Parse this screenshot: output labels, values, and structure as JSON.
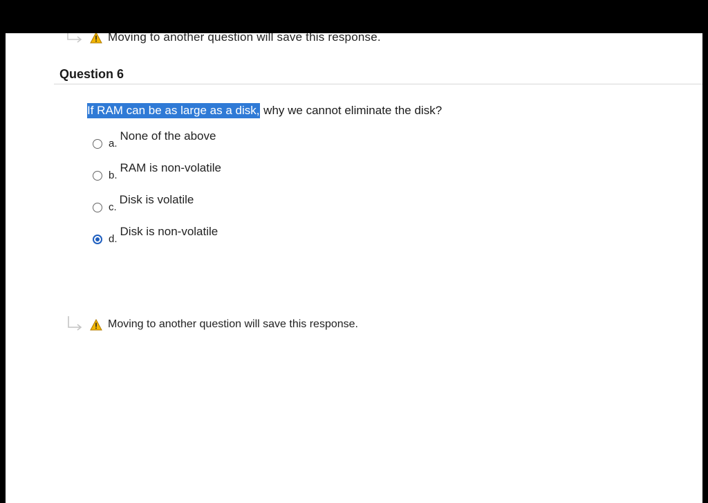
{
  "warning_top": {
    "text": "Moving to another question will save this response."
  },
  "question": {
    "header": "Question 6",
    "text_highlighted": "If RAM can be as large as a disk,",
    "text_rest": " why we cannot eliminate the disk?",
    "options": [
      {
        "letter": "a.",
        "label": "None of the above",
        "selected": false
      },
      {
        "letter": "b.",
        "label": "RAM is non-volatile",
        "selected": false
      },
      {
        "letter": "c.",
        "label": "Disk is volatile",
        "selected": false
      },
      {
        "letter": "d.",
        "label": "Disk is non-volatile",
        "selected": true
      }
    ]
  },
  "warning_bottom": {
    "text": "Moving to another question will save this response."
  },
  "icons": {
    "arrow": "return-arrow-icon",
    "warning": "warning-icon"
  },
  "colors": {
    "highlight": "#2f7ad6",
    "radio_selected": "#1f5fbf",
    "warning_yellow": "#f2b600"
  }
}
